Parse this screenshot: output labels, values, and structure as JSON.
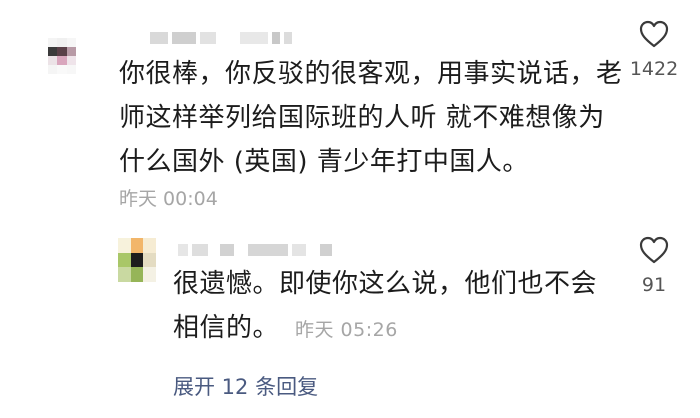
{
  "comments": [
    {
      "text_line1": "你很棒，你反驳的很客观，用事实说话，老",
      "text_line2": "师这样举列给国际班的人听 就不难想像为",
      "text_line3": "什么国外 (英国) 青少年打中国人。",
      "time": "昨天 00:04",
      "likes": "1422"
    }
  ],
  "reply": {
    "text_line1": "很遗憾。即使你这么说，他们也不会",
    "text_line2": "相信的。",
    "time": "昨天 05:26",
    "likes": "91"
  },
  "expand_replies_label": "展开 12 条回复",
  "colors": {
    "text": "#1c1c1c",
    "meta": "#a6a6a6",
    "link": "#4a5a80",
    "icon": "#3a3a3a"
  },
  "icons": {
    "like": "heart-outline-icon"
  }
}
